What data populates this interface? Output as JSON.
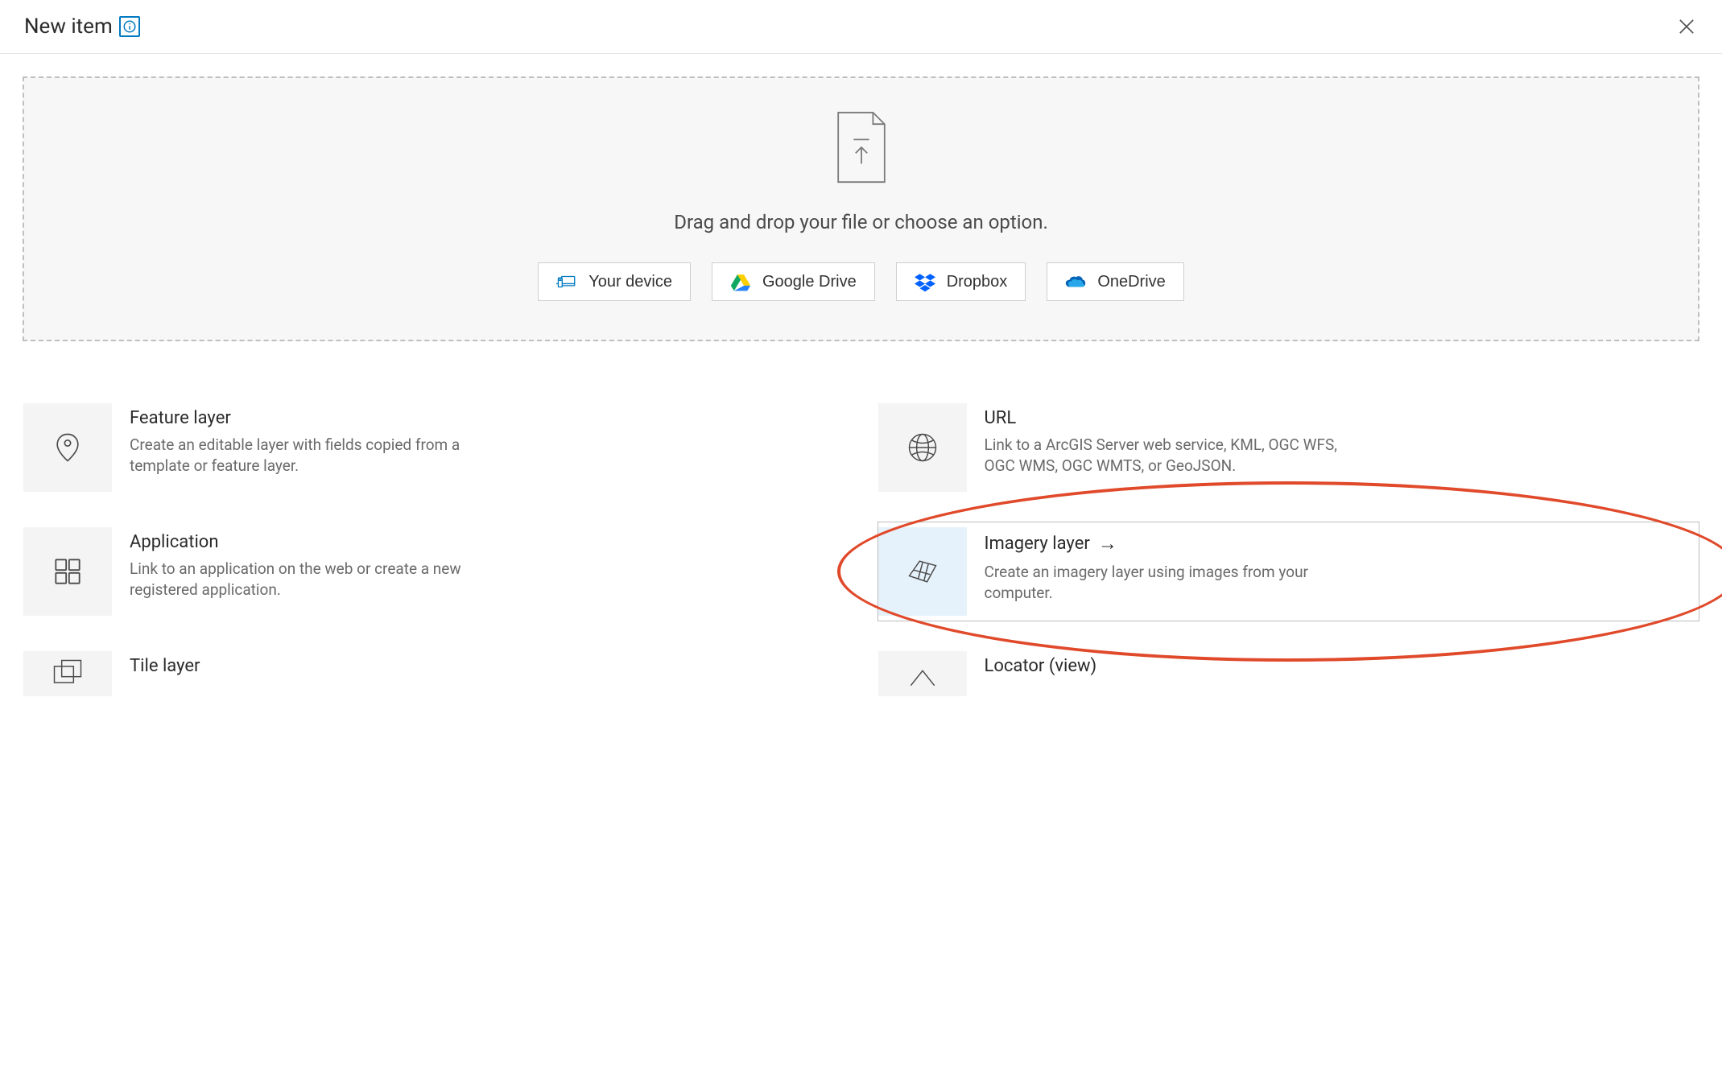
{
  "header": {
    "title": "New item",
    "info_icon": "info-icon",
    "close_icon": "close-icon"
  },
  "dropzone": {
    "instruction": "Drag and drop your file or choose an option.",
    "sources": {
      "device": "Your device",
      "gdrive": "Google Drive",
      "dropbox": "Dropbox",
      "onedrive": "OneDrive"
    }
  },
  "options": {
    "feature_layer": {
      "title": "Feature layer",
      "desc": "Create an editable layer with fields copied from a template or feature layer."
    },
    "url": {
      "title": "URL",
      "desc": "Link to a ArcGIS Server web service, KML, OGC WFS, OGC WMS, OGC WMTS, or GeoJSON."
    },
    "application": {
      "title": "Application",
      "desc": "Link to an application on the web or create a new registered application."
    },
    "imagery_layer": {
      "title": "Imagery layer",
      "desc": "Create an imagery layer using images from your computer."
    },
    "tile_layer": {
      "title": "Tile layer",
      "desc": ""
    },
    "locator_view": {
      "title": "Locator (view)",
      "desc": ""
    }
  },
  "colors": {
    "accent": "#0079c1",
    "annotation": "#e04a2b"
  }
}
